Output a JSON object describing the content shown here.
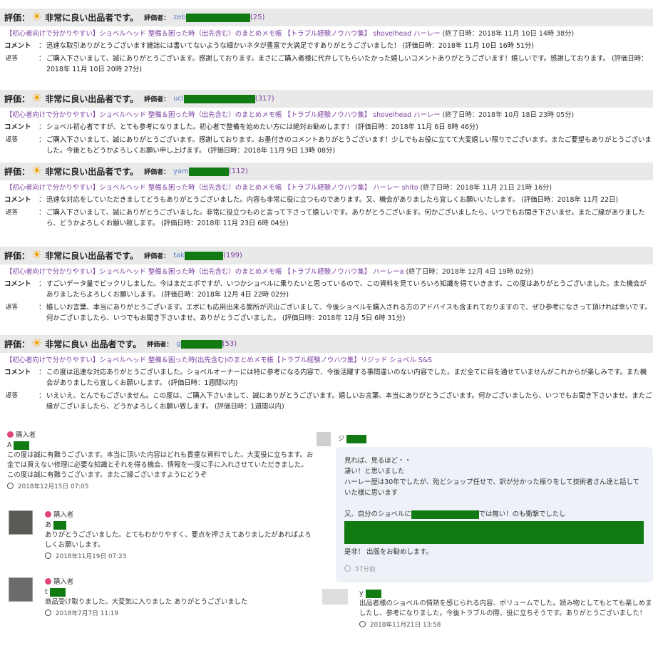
{
  "labels": {
    "rating": "評価：",
    "excellent": "非常に良い出品者です。",
    "excellent_spaced": "非常に良い 出品者です。",
    "rater": "評価者：",
    "comment": "コメント",
    "reply": "返答",
    "colon": "："
  },
  "reviews": [
    {
      "rater_prefix": "zeb",
      "count": "(25)",
      "item": "【初心者向けで分かりやすい】ショベルヘッド 整備＆困った時（出先含む）のまとめメモ帳 【トラブル経験ノウハウ集】 shovelhead ハーレー",
      "item_suffix": "(終了日時：2018年 11月 10日 14時 38分)",
      "comment": "迅速な取引ありがとうございます雑誌には書いてないような細かいネタが豊富で大満足ですありがとうございました！ (評価日時：2018年 11月 10日 16時 51分)",
      "reply": "ご購入下さいまして、誠にありがとうございます。感謝しております。まさにご購入者様に代弁してもらいたかった嬉しいコメントありがとうございます！嬉しいです。感謝しております。 (評価日時：2018年 11月 10日 20時 27分)"
    },
    {
      "rater_prefix": "ucl",
      "count": "(317)",
      "item": "【初心者向けで分かりやすい】ショベルヘッド 整備＆困った時（出先含む）のまとめメモ帳 【トラブル経験ノウハウ集】 shovelhead ハーレー",
      "item_suffix": "(終了日時：2018年 10月 18日 23時 05分)",
      "comment": "ショベル初心者ですが、とても参考になりました。初心者で整備を始めたい方には絶対お勧めします！ (評価日時：2018年 11月 6日 8時 46分)",
      "reply": "ご購入下さいまして、誠にありがとうございます。感謝しております。お墨付きのコメントありがとうございます！少しでもお役に立てて大変嬉しい限りでございます。またご要望もありがとうございました。今後ともどうかよろしくお願い申し上げます。 (評価日時：2018年 11月 9日 13時 08分)"
    },
    {
      "rater_prefix": "yam",
      "count": "(112)",
      "item": "【初心者向けで分かりやすい】ショベルヘッド 整備＆困った時（出先含む）のまとめメモ帳 【トラブル経験ノウハウ集】 ハーレー shito",
      "item_suffix": "(終了日時：2018年 11月 21日 21時 16分)",
      "comment": "迅速な対応をしていただきましてどうもありがとうございました。内容も非常に役に立つものであります。又、機会がありましたら宜しくお願いいたします。 (評価日時：2018年 11月 22日)",
      "reply": "ご購入下さいまして、誠にありがとうございました。非常に役立つものと言って下さって嬉しいです。ありがとうございます。何かございましたら、いつでもお聞き下さいませ。またご縁がありましたら、どうかよろしくお願い致します。 (評価日時：2018年 11月 23日 6時 04分)"
    },
    {
      "rater_prefix": "tak",
      "count": "(199)",
      "item": "【初心者向けで分かりやすい】ショベルヘッド 整備＆困った時（出先含む）のまとめメモ帳 【トラブル経験ノウハウ集】 ハーレーa",
      "item_suffix": "(終了日時：2018年 12月 4日 19時 02分)",
      "comment": "すごいデータ量でビックリしました。今はまだエボですが、いつかショベルに乗りたいと思っているので、この資料を見ていろいろ知識を得ていきます。この度はありがとうございました。また機会がありましたらよろしくお願いします。 (評価日時：2018年 12月 4日 22時 02分)",
      "reply": "嬉しいお言葉、本当にありがとうございます。エボにも応用出来る箇所が沢山ございまして、今後ショベルを購入される方のアドバイスも含まれておりますので、ぜひ参考になさって頂ければ幸いです。何かございましたら、いつでもお聞き下さいませ。ありがとうございました。 (評価日時：2018年 12月 5日 6時 31分)"
    },
    {
      "rater_prefix": "g",
      "count": "(53)",
      "item": "【初心者向けで分かりやすい】ショベルヘッド 整備＆困った時(出先含む)のまとめメモ帳【トラブル経験ノウハウ集】リジッド ショベル S&S",
      "item_suffix": "",
      "comment": "この度は迅速な対応ありがとうございました。ショベルオーナーには特に参考になる内容で、今後活躍する事間違いのない内容でした。まだ全てに目を通せていませんがこれからが楽しみです。また機会がありましたら宜しくお願いします。 (評価日時：1週間以内)",
      "reply": "いえいえ、とんでもございません。この度は、ご購入下さいまして、誠にありがとうございます。嬉しいお言葉、本当にありがとうございます。何かございましたら、いつでもお聞き下さいませ。またご縁がございましたら、どうかよろしくお願い致します。 (評価日時：1週間以内)"
    }
  ],
  "chat": {
    "buyer_label": "購入者",
    "left_messages": [
      {
        "name": "A",
        "text": "この度は誠に有難うございます。本当に頂いた内容はどれも貴重な資料でした。大変役に立ちます。お金では買えない修理に必要な知識とそれを得る機会、情報を一度に手に入れさせていただきました。この度は誠に有難うございます。またご縁ございますようにどうぞ",
        "time": "2018年12月15日 07:05"
      },
      {
        "name": "あ",
        "text": "ありがとうございました。とてもわかりやすく、要点を押さえてありましたがあればよろしくお願いします。",
        "time": "2018年11月19日 07:23"
      },
      {
        "name": "t",
        "text": "商品受け取りました。大変気に入りました ありがとうございました",
        "time": "2018年7月7日 11:19"
      }
    ],
    "right_bubble": {
      "name": "ジ",
      "lines": [
        "見れば、見るほど・・",
        "凄い！と思いました",
        "ハーレー歴は30年でしたが、殆どショップ任せで、訳が分かった振りをして技術者さん達と話していた様に思います",
        "",
        "又、自分のショベルに",
        "では無い！のも衝撃でしたし",
        "是非！ 出版をお勧めします。"
      ],
      "time": "57分前"
    },
    "right_message": {
      "name": "y",
      "text": "出品者様のショベルの情熱を感じられる内容、ボリュームでした。読み物としてもとても楽しめましたし、参考になりました。今後トラブルの際、役に立ちそうです。ありがとうございました！",
      "time": "2018年11月21日 13:58"
    }
  },
  "colors": {
    "header_bg": "#e9e9e9",
    "item_link": "#7b3fa0",
    "rater_link": "#5b7fc7",
    "redaction": "#127a12",
    "sun": "#f4a300",
    "bubble_bg": "#eef1f7"
  }
}
